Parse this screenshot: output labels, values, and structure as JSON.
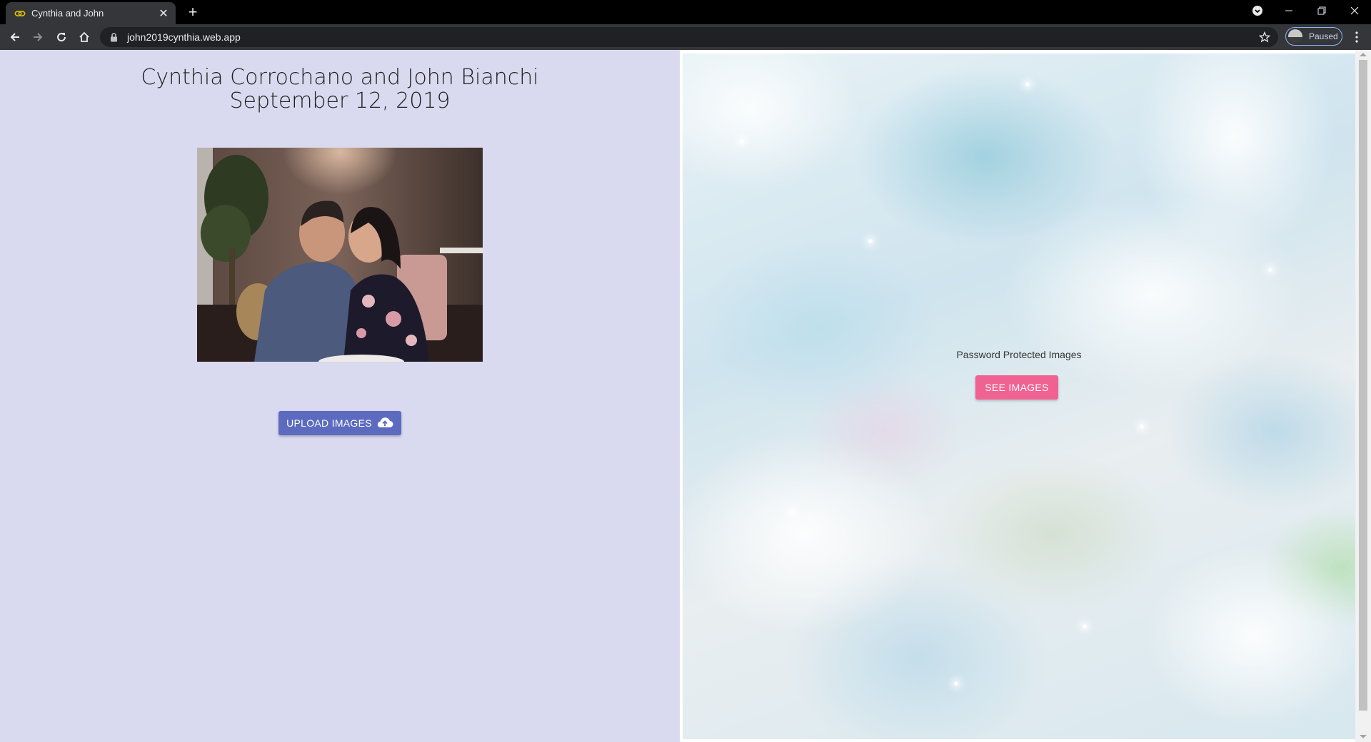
{
  "browser": {
    "tab_title": "Cynthia and John",
    "url": "john2019cynthia.web.app",
    "profile_label": "Paused"
  },
  "page": {
    "title_line1": "Cynthia Corrochano and John Bianchi",
    "title_line2": "September 12, 2019",
    "upload_button": "UPLOAD IMAGES",
    "protected_label": "Password Protected Images",
    "see_button": "SEE IMAGES"
  },
  "colors": {
    "left_panel_bg": "#d9daef",
    "upload_button_bg": "#5c6bc0",
    "see_button_bg": "#f06292"
  },
  "icons": {
    "favicon": "rings-icon",
    "upload": "cloud-upload-icon"
  }
}
